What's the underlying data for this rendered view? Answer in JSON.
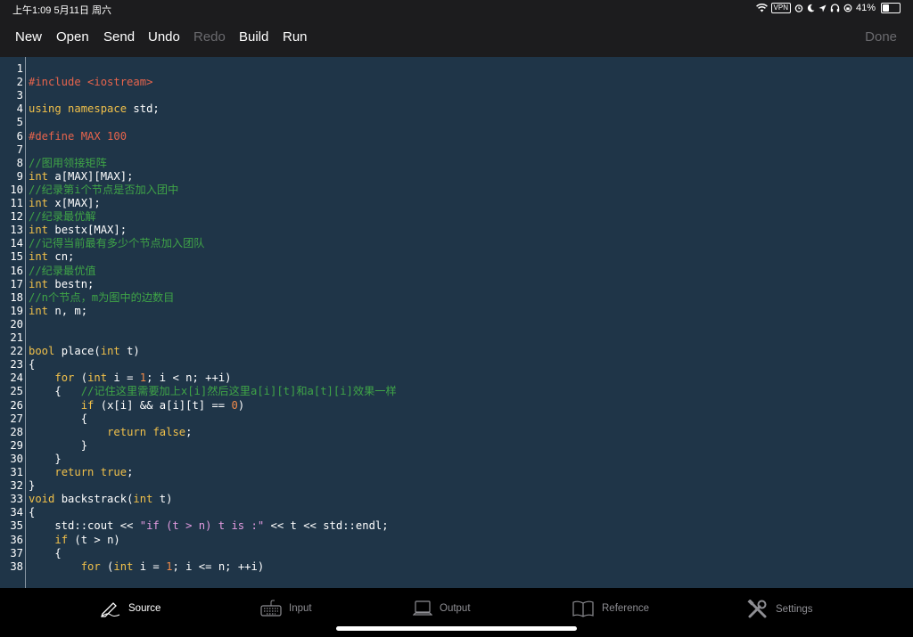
{
  "status": {
    "time_date": "上午1:09   5月11日 周六",
    "vpn": "VPN",
    "battery": "41%",
    "battery_level": 0.41,
    "icons": [
      "wifi-icon",
      "alarm-icon",
      "moon-icon",
      "location-icon",
      "headphones-icon",
      "lock-rotation-icon",
      "battery-icon"
    ]
  },
  "toolbar": {
    "new": "New",
    "open": "Open",
    "send": "Send",
    "undo": "Undo",
    "redo": "Redo",
    "build": "Build",
    "run": "Run",
    "done": "Done"
  },
  "editor": {
    "colors": {
      "background": "#1f3548",
      "preprocessor": "#e7644c",
      "keyword": "#f0c04a",
      "comment": "#3fa447",
      "number": "#f08a4a",
      "string": "#e39be0"
    },
    "lines": [
      {
        "n": "1",
        "parts": []
      },
      {
        "n": "2",
        "parts": [
          [
            "pp",
            "#include <iostream>"
          ]
        ]
      },
      {
        "n": "3",
        "parts": []
      },
      {
        "n": "4",
        "parts": [
          [
            "kw",
            "using"
          ],
          [
            "",
            " "
          ],
          [
            "kw",
            "namespace"
          ],
          [
            "",
            " std;"
          ]
        ]
      },
      {
        "n": "5",
        "parts": []
      },
      {
        "n": "6",
        "parts": [
          [
            "pp",
            "#define MAX 100"
          ]
        ]
      },
      {
        "n": "7",
        "parts": []
      },
      {
        "n": "8",
        "parts": [
          [
            "cm",
            "//图用领接矩阵"
          ]
        ]
      },
      {
        "n": "9",
        "parts": [
          [
            "kw",
            "int"
          ],
          [
            "",
            " a[MAX][MAX];"
          ]
        ]
      },
      {
        "n": "10",
        "parts": [
          [
            "cm",
            "//纪录第i个节点是否加入团中"
          ]
        ]
      },
      {
        "n": "11",
        "parts": [
          [
            "kw",
            "int"
          ],
          [
            "",
            " x[MAX];"
          ]
        ]
      },
      {
        "n": "12",
        "parts": [
          [
            "cm",
            "//纪录最优解"
          ]
        ]
      },
      {
        "n": "13",
        "parts": [
          [
            "kw",
            "int"
          ],
          [
            "",
            " bestx[MAX];"
          ]
        ]
      },
      {
        "n": "14",
        "parts": [
          [
            "cm",
            "//记得当前最有多少个节点加入团队"
          ]
        ]
      },
      {
        "n": "15",
        "parts": [
          [
            "kw",
            "int"
          ],
          [
            "",
            " cn;"
          ]
        ]
      },
      {
        "n": "16",
        "parts": [
          [
            "cm",
            "//纪录最优值"
          ]
        ]
      },
      {
        "n": "17",
        "parts": [
          [
            "kw",
            "int"
          ],
          [
            "",
            " bestn;"
          ]
        ]
      },
      {
        "n": "18",
        "parts": [
          [
            "cm",
            "//n个节点，m为图中的边数目"
          ]
        ]
      },
      {
        "n": "19",
        "parts": [
          [
            "kw",
            "int"
          ],
          [
            "",
            " n, m;"
          ]
        ]
      },
      {
        "n": "20",
        "parts": []
      },
      {
        "n": "21",
        "parts": []
      },
      {
        "n": "22",
        "parts": [
          [
            "kw",
            "bool"
          ],
          [
            "",
            " place("
          ],
          [
            "kw",
            "int"
          ],
          [
            "",
            " t)"
          ]
        ]
      },
      {
        "n": "23",
        "parts": [
          [
            "",
            "{"
          ]
        ]
      },
      {
        "n": "24",
        "parts": [
          [
            "",
            "    "
          ],
          [
            "kw",
            "for"
          ],
          [
            "",
            " ("
          ],
          [
            "kw",
            "int"
          ],
          [
            "",
            " i = "
          ],
          [
            "num",
            "1"
          ],
          [
            "",
            "; i < n; ++i)"
          ]
        ]
      },
      {
        "n": "25",
        "parts": [
          [
            "",
            "    {   "
          ],
          [
            "cm",
            "//记住这里需要加上x[i]然后这里a[i][t]和a[t][i]效果一样"
          ]
        ]
      },
      {
        "n": "26",
        "parts": [
          [
            "",
            "        "
          ],
          [
            "kw",
            "if"
          ],
          [
            "",
            " (x[i] && a[i][t] == "
          ],
          [
            "num",
            "0"
          ],
          [
            "",
            ")"
          ]
        ]
      },
      {
        "n": "27",
        "parts": [
          [
            "",
            "        {"
          ]
        ]
      },
      {
        "n": "28",
        "parts": [
          [
            "",
            "            "
          ],
          [
            "kw",
            "return"
          ],
          [
            "",
            " "
          ],
          [
            "kw",
            "false"
          ],
          [
            "",
            ";"
          ]
        ]
      },
      {
        "n": "29",
        "parts": [
          [
            "",
            "        }"
          ]
        ]
      },
      {
        "n": "30",
        "parts": [
          [
            "",
            "    }"
          ]
        ]
      },
      {
        "n": "31",
        "parts": [
          [
            "",
            "    "
          ],
          [
            "kw",
            "return"
          ],
          [
            "",
            " "
          ],
          [
            "kw",
            "true"
          ],
          [
            "",
            ";"
          ]
        ]
      },
      {
        "n": "32",
        "parts": [
          [
            "",
            "}"
          ]
        ]
      },
      {
        "n": "33",
        "parts": [
          [
            "kw",
            "void"
          ],
          [
            "",
            " backstrack("
          ],
          [
            "kw",
            "int"
          ],
          [
            "",
            " t)"
          ]
        ]
      },
      {
        "n": "34",
        "parts": [
          [
            "",
            "{"
          ]
        ]
      },
      {
        "n": "35",
        "parts": [
          [
            "",
            "    std::cout << "
          ],
          [
            "str",
            "\"if (t > n) t is :\""
          ],
          [
            "",
            " << t << std::endl;"
          ]
        ]
      },
      {
        "n": "36",
        "parts": [
          [
            "",
            "    "
          ],
          [
            "kw",
            "if"
          ],
          [
            "",
            " (t > n)"
          ]
        ]
      },
      {
        "n": "37",
        "parts": [
          [
            "",
            "    {"
          ]
        ]
      },
      {
        "n": "38",
        "parts": [
          [
            "",
            "        "
          ],
          [
            "kw",
            "for"
          ],
          [
            "",
            " ("
          ],
          [
            "kw",
            "int"
          ],
          [
            "",
            " i = "
          ],
          [
            "num",
            "1"
          ],
          [
            "",
            "; i <= n; ++i)"
          ]
        ]
      }
    ]
  },
  "tabs": {
    "source": "Source",
    "input": "Input",
    "output": "Output",
    "reference": "Reference",
    "settings": "Settings"
  }
}
